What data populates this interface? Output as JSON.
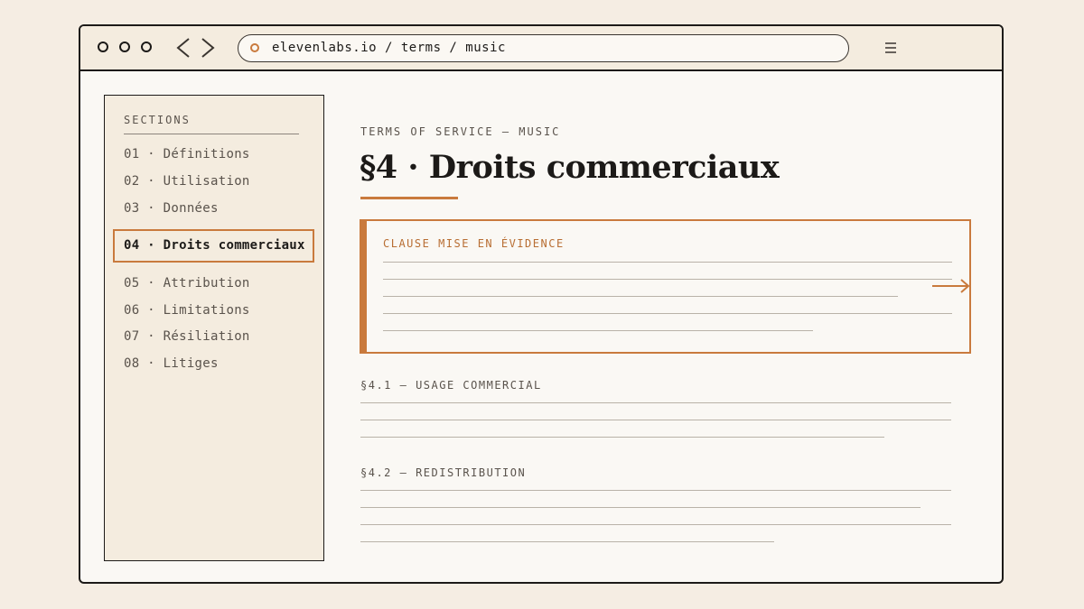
{
  "browser": {
    "url": "elevenlabs.io / terms / music"
  },
  "sidebar": {
    "heading": "SECTIONS",
    "items": [
      {
        "label": "01 · Définitions",
        "active": false
      },
      {
        "label": "02 · Utilisation",
        "active": false
      },
      {
        "label": "03 · Données",
        "active": false
      },
      {
        "label": "04 · Droits commerciaux",
        "active": true
      },
      {
        "label": "05 · Attribution",
        "active": false
      },
      {
        "label": "06 · Limitations",
        "active": false
      },
      {
        "label": "07 · Résiliation",
        "active": false
      },
      {
        "label": "08 · Litiges",
        "active": false
      }
    ]
  },
  "main": {
    "kicker": "TERMS OF SERVICE — MUSIC",
    "title": "§4 · Droits commerciaux",
    "callout": {
      "label": "CLAUSE MISE EN ÉVIDENCE"
    },
    "subsections": [
      {
        "heading": "§4.1 — USAGE COMMERCIAL"
      },
      {
        "heading": "§4.2 — REDISTRIBUTION"
      }
    ]
  },
  "colors": {
    "accent": "#c97a3d",
    "ink": "#1c1a18",
    "page_background": "#f5ede3",
    "sidebar_background": "#f4ecdf"
  },
  "icons": [
    "window-control-circle-icon",
    "back-arrow-icon",
    "forward-arrow-icon",
    "site-status-icon",
    "menu-icon",
    "arrow-right-icon"
  ]
}
